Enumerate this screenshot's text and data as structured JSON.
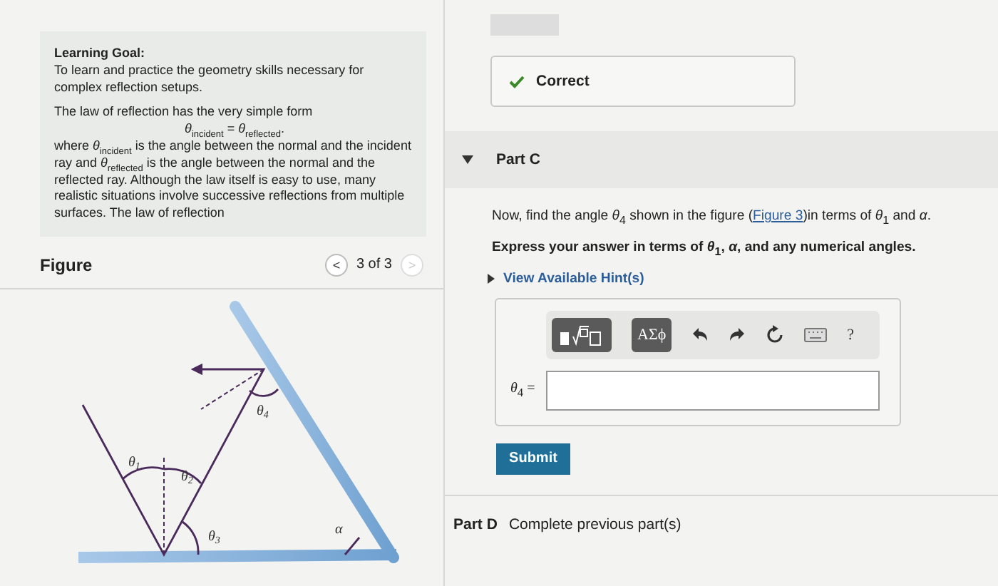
{
  "learning_goal": {
    "title": "Learning Goal:",
    "goal": "To learn and practice the geometry skills necessary for complex reflection setups.",
    "law_intro": "The law of reflection has the very simple form",
    "equation": "*θ*$_{incident}$ = *θ*$_{reflected}$.",
    "explanation": "where *θ*$_{incident}$ is the angle between the normal and the incident ray and *θ*$_{reflected}$ is the angle between the normal and the reflected ray. Although the law itself is easy to use, many realistic situations involve successive reflections from multiple surfaces. The law of reflection"
  },
  "figure": {
    "title": "Figure",
    "counter": "3 of 3",
    "prev": "<",
    "next": ">",
    "next_disabled": true,
    "labels": [
      "*θ*$_{1}$",
      "*θ*$_{2}$",
      "*θ*$_{3}$",
      "*θ*$_{4}$",
      "*α*"
    ]
  },
  "previous_part": {
    "status": "Correct"
  },
  "part_c": {
    "title": "Part C",
    "expanded": true,
    "question": {
      "before": "Now, find the angle *θ*$_{4}$ shown in the figure (",
      "link": "Figure 3",
      "after": ")in terms of *θ*$_{1}$ and *α*."
    },
    "instruction": "Express your answer in terms of *θ*$_{1}$, *α*, and any numerical angles.",
    "hint": "View Available Hint(s)",
    "toolbar": [
      {
        "kind": "template"
      },
      {
        "kind": "text",
        "label": "ΑΣϕ"
      },
      {
        "kind": "undo"
      },
      {
        "kind": "redo"
      },
      {
        "kind": "reset"
      },
      {
        "kind": "keyboard"
      },
      {
        "kind": "help",
        "label": "?"
      }
    ],
    "answer_label": "*θ*$_{4}$ =",
    "submit": "Submit"
  },
  "part_d": {
    "title": "Part D",
    "status": "Complete previous part(s)"
  }
}
